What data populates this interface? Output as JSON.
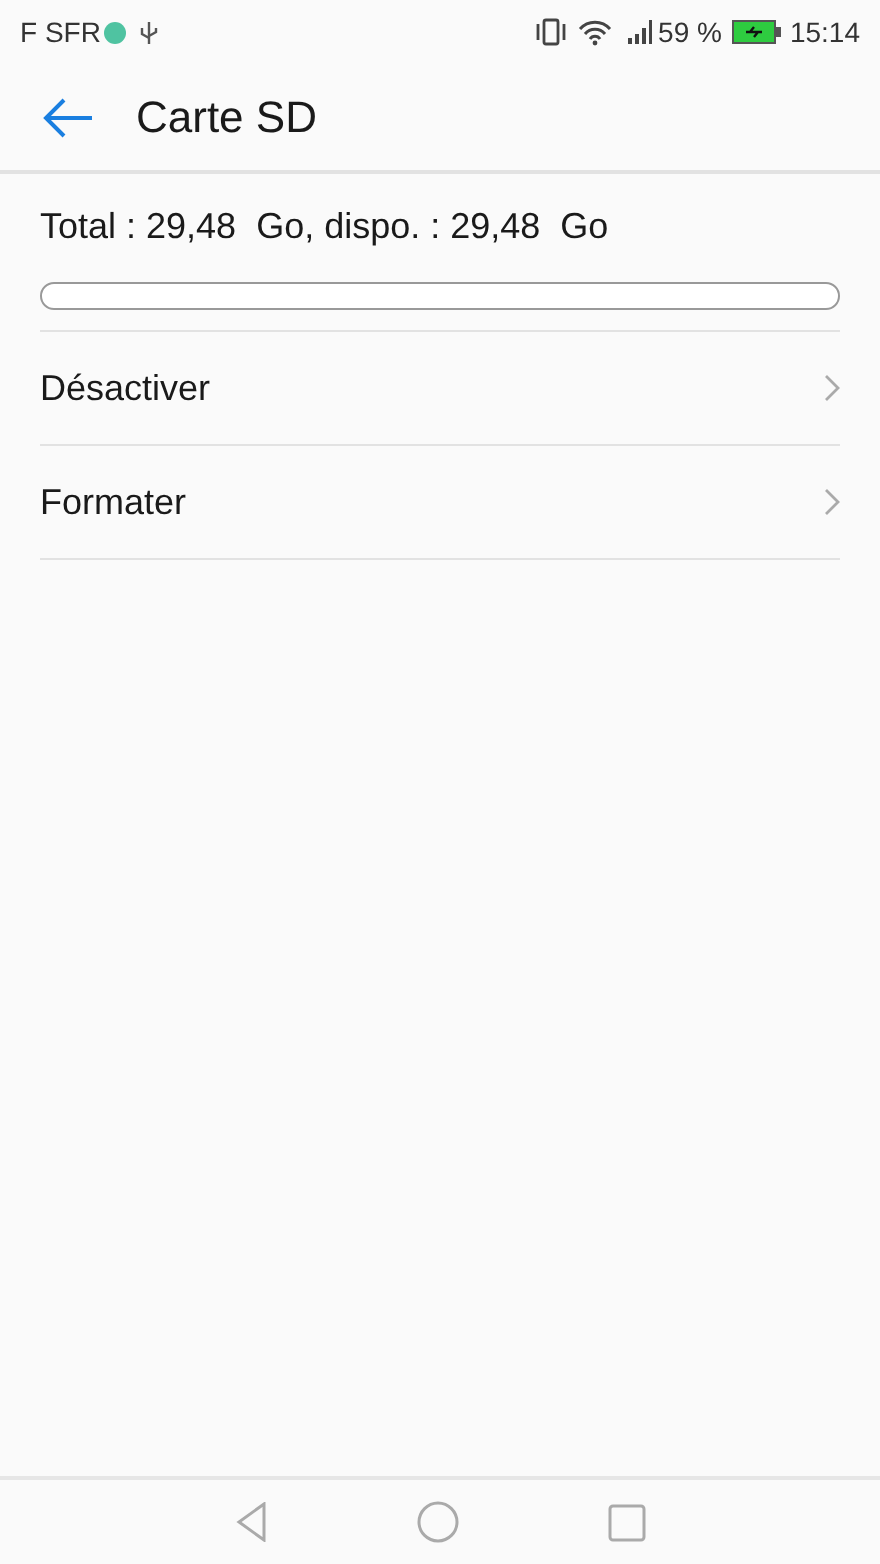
{
  "status_bar": {
    "carrier": "F SFR",
    "battery": "59 %",
    "time": "15:14"
  },
  "header": {
    "title": "Carte SD"
  },
  "storage": {
    "summary": "Total : 29,48  Go, dispo. : 29,48  Go",
    "level": 0
  },
  "items": [
    {
      "label": "Désactiver"
    },
    {
      "label": "Formater"
    }
  ]
}
